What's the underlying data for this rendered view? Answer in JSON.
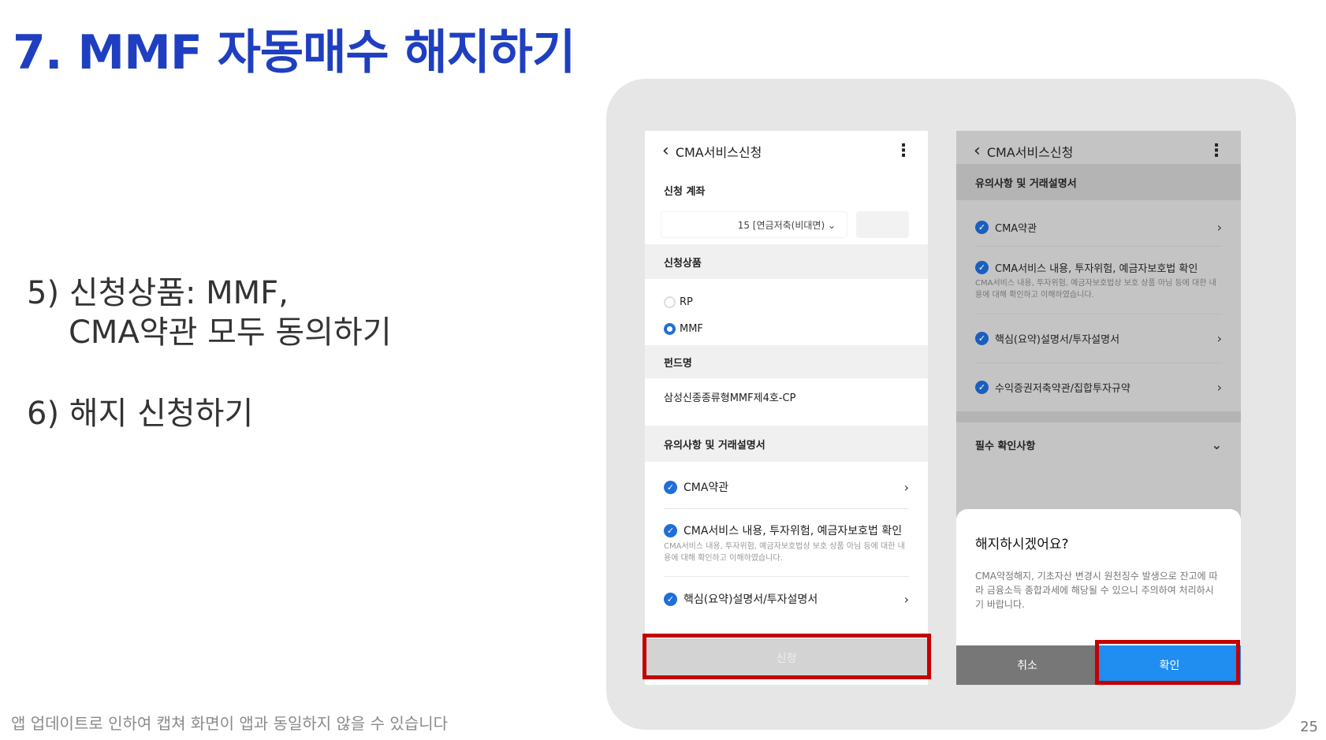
{
  "slide": {
    "title": "7. MMF 자동매수 해지하기",
    "step5_line1": "5) 신청상품: MMF,",
    "step5_line2": "CMA약관 모두 동의하기",
    "step6": "6) 해지 신청하기",
    "footnote": "앱 업데이트로 인하여 캡쳐 화면이 앱과 동일하지 않을 수 있습니다",
    "page_number": "25"
  },
  "left_screen": {
    "header_title": "CMA서비스신청",
    "account_label": "신청 계좌",
    "account_value": "15 [연금저축(비대면) ⌄",
    "product_label": "신청상품",
    "option_rp": "RP",
    "option_mmf": "MMF",
    "selected_option": "MMF",
    "fund_label": "펀드명",
    "fund_value": "삼성신종종류형MMF제4호-CP",
    "notice_label": "유의사항 및 거래설명서",
    "item1": "CMA약관",
    "item2": "CMA서비스 내용, 투자위험, 예금자보호법 확인",
    "item2_desc": "CMA서비스 내용, 투자위험, 예금자보호법상 보호 상품 아님 등에 대한 내용에 대해 확인하고 이해하였습니다.",
    "item3": "핵심(요약)설명서/투자설명서",
    "submit_label": "신청"
  },
  "right_screen": {
    "header_title": "CMA서비스신청",
    "notice_label": "유의사항 및 거래설명서",
    "item1": "CMA약관",
    "item2": "CMA서비스 내용, 투자위험, 예금자보호법 확인",
    "item2_desc": "CMA서비스 내용, 투자위험, 예금자보호법상 보호 상품 아님 등에 대한 내용에 대해 확인하고 이해하였습니다.",
    "item3": "핵심(요약)설명서/투자설명서",
    "item4": "수익증권저축약관/집합투자규약",
    "required_label": "필수 확인사항",
    "dialog_title": "해지하시겠어요?",
    "dialog_body": "CMA약정해지, 기초자산 변경시 원천징수 발생으로 잔고에 따라 금융소득 종합과세에 해당될 수 있으니 주의하여 처리하시기 바랍니다.",
    "cancel_label": "취소",
    "confirm_label": "확인"
  },
  "icons": {
    "back": "chevron-left-icon",
    "more": "more-vertical-icon",
    "check": "check-circle-icon",
    "chevron": "chevron-right-icon",
    "expand": "chevron-down-icon"
  },
  "colors": {
    "title": "#1f3fc0",
    "check": "#1f6fd8",
    "confirm_button": "#1f8ef0",
    "highlight_box": "#c40000"
  }
}
